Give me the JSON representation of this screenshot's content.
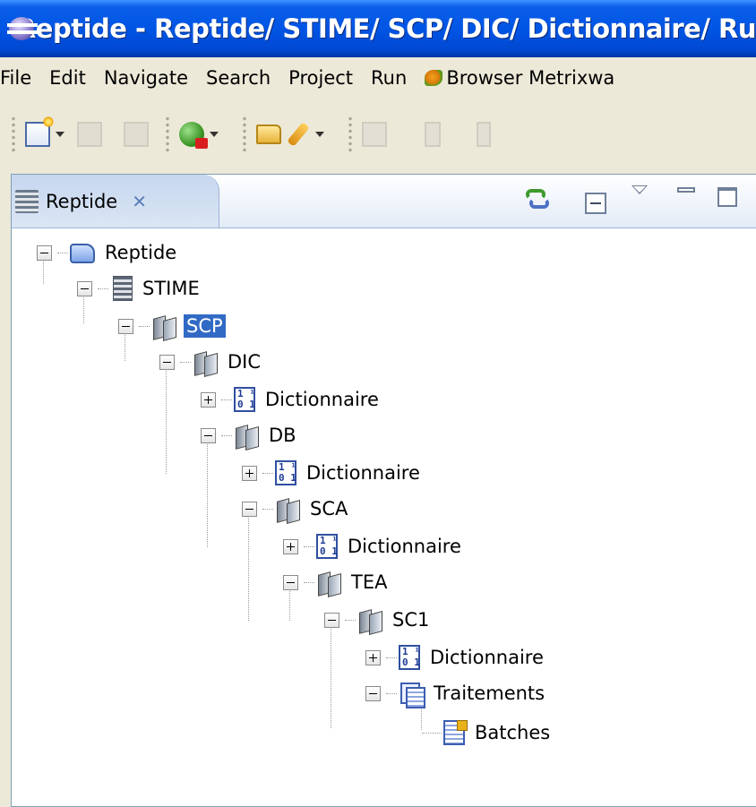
{
  "window": {
    "title": "Reptide - Reptide/ STIME/ SCP/ DIC/ Dictionnaire/ Ru"
  },
  "menu": {
    "items": [
      "File",
      "Edit",
      "Navigate",
      "Search",
      "Project",
      "Run",
      "Browser Metrixwa"
    ]
  },
  "view": {
    "tab_label": "Reptide",
    "close_label": "✕"
  },
  "tree": {
    "nodes": [
      {
        "label": "Reptide",
        "icon": "project-icon",
        "state": "expanded",
        "depth": 0
      },
      {
        "label": "STIME",
        "icon": "database-icon",
        "state": "expanded",
        "depth": 1
      },
      {
        "label": "SCP",
        "icon": "servers-icon",
        "state": "expanded",
        "depth": 2,
        "selected": true
      },
      {
        "label": "DIC",
        "icon": "servers-icon",
        "state": "expanded",
        "depth": 3
      },
      {
        "label": "Dictionnaire",
        "icon": "dictionary-icon",
        "state": "collapsed",
        "depth": 4
      },
      {
        "label": "DB",
        "icon": "servers-icon",
        "state": "expanded",
        "depth": 4
      },
      {
        "label": "Dictionnaire",
        "icon": "dictionary-icon",
        "state": "collapsed",
        "depth": 5
      },
      {
        "label": "SCA",
        "icon": "servers-icon",
        "state": "expanded",
        "depth": 5
      },
      {
        "label": "Dictionnaire",
        "icon": "dictionary-icon",
        "state": "collapsed",
        "depth": 6
      },
      {
        "label": "TEA",
        "icon": "servers-icon",
        "state": "expanded",
        "depth": 6
      },
      {
        "label": "SC1",
        "icon": "servers-icon",
        "state": "expanded",
        "depth": 7
      },
      {
        "label": "Dictionnaire",
        "icon": "dictionary-icon",
        "state": "collapsed",
        "depth": 8
      },
      {
        "label": "Traitements",
        "icon": "traitements-icon",
        "state": "expanded",
        "depth": 8
      },
      {
        "label": "Batches",
        "icon": "batches-icon",
        "state": "leaf",
        "depth": 9
      }
    ]
  },
  "colors": {
    "titlebar": "#0055e5",
    "selection": "#316ac5",
    "chrome": "#ece9d8"
  }
}
